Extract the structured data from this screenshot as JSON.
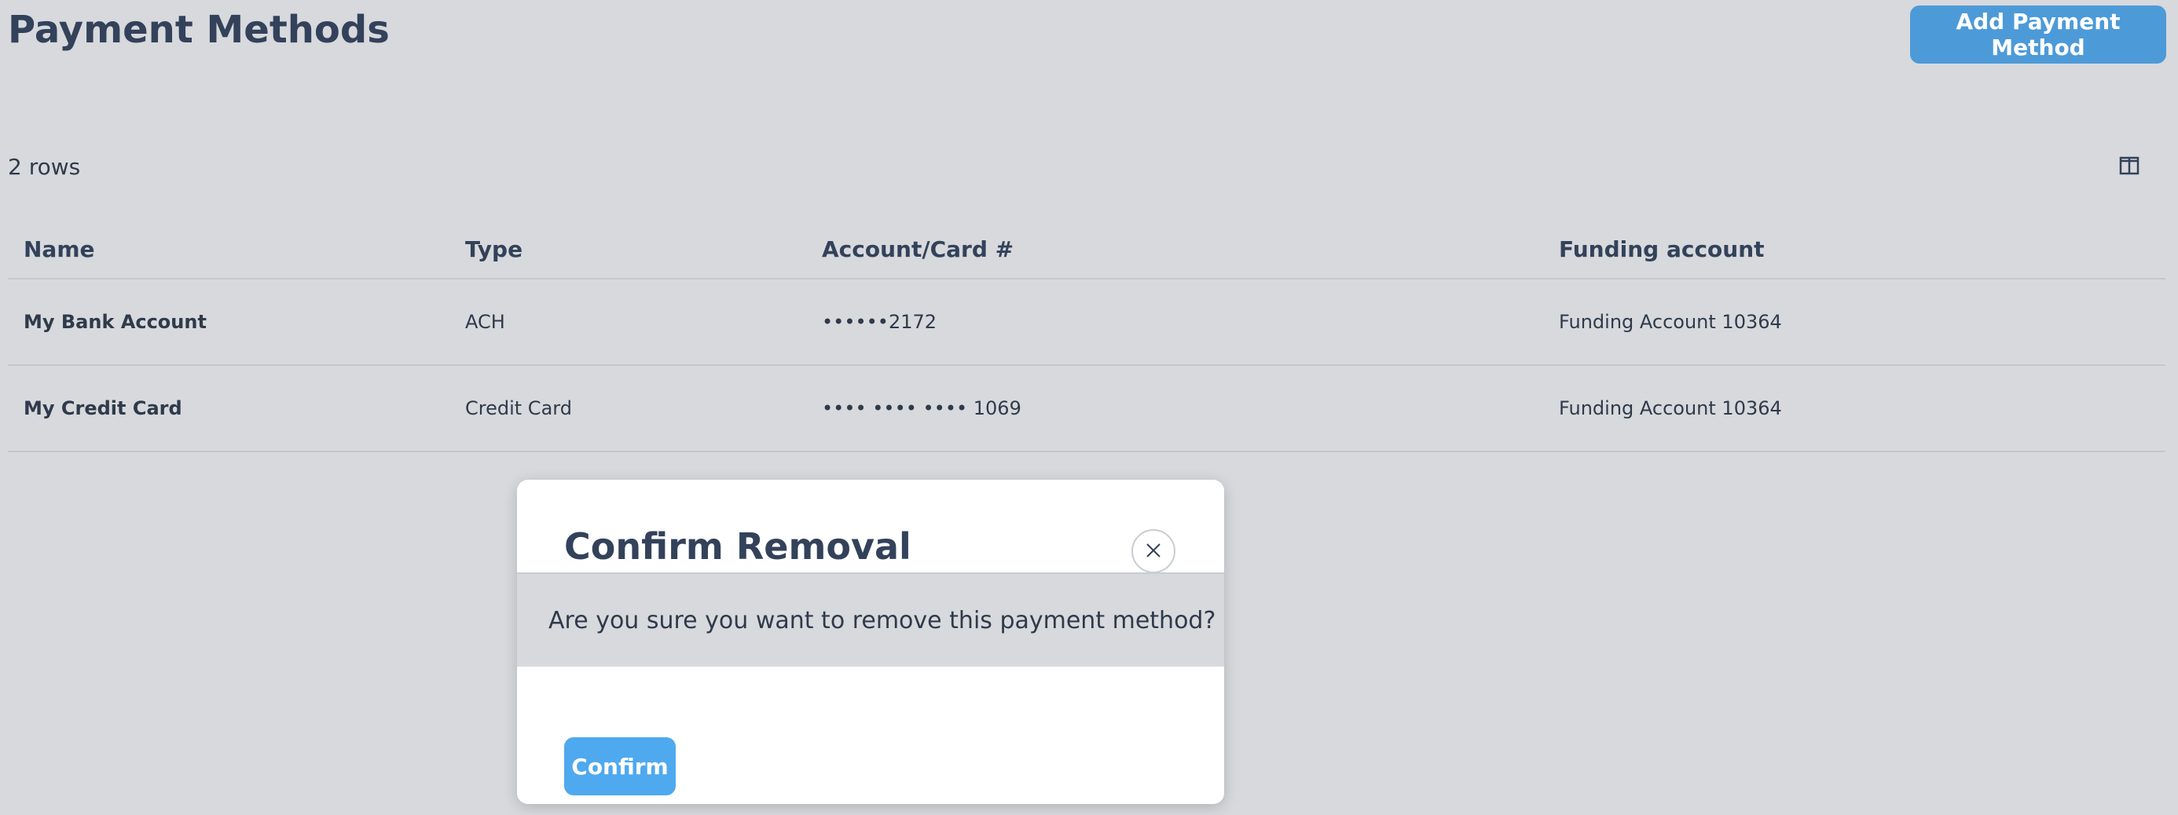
{
  "header": {
    "title": "Payment Methods",
    "add_button_label": "Add Payment Method"
  },
  "table": {
    "row_count_label": "2 rows",
    "columns": [
      "Name",
      "Type",
      "Account/Card #",
      "Funding account"
    ],
    "rows": [
      [
        "My Bank Account",
        "ACH",
        "••••••2172",
        "Funding Account 10364"
      ],
      [
        "My Credit Card",
        "Credit Card",
        "•••• •••• •••• 1069",
        "Funding Account 10364"
      ]
    ]
  },
  "modal": {
    "title": "Confirm Removal",
    "message": "Are you sure you want to remove this payment method?",
    "confirm_label": "Confirm"
  },
  "colors": {
    "background": "#d7d9dd",
    "primary_button": "#4d9ad8",
    "confirm_button": "#4fa9ee",
    "text": "#33425a"
  }
}
